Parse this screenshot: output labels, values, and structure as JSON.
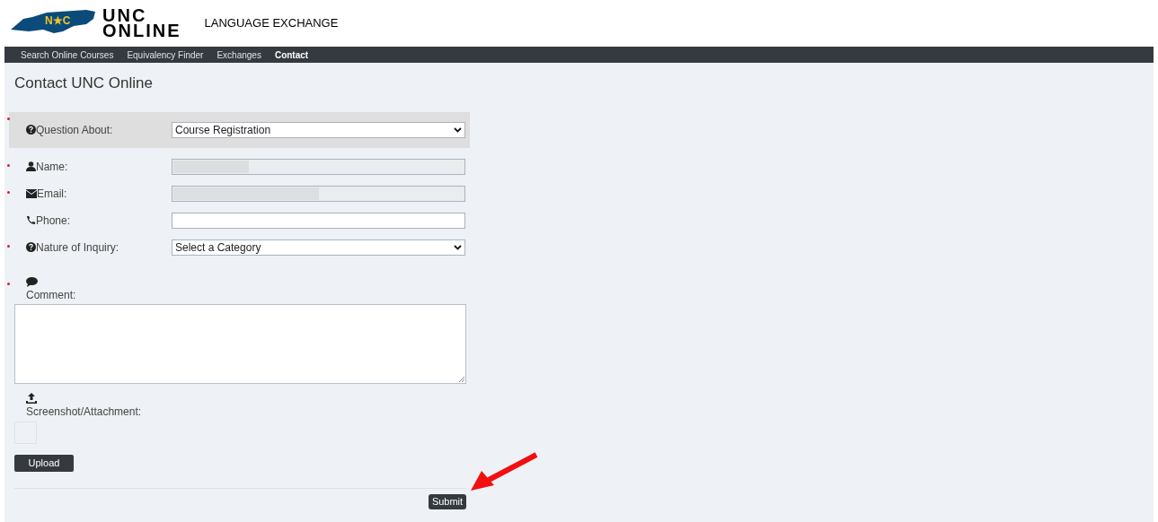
{
  "header": {
    "logo_text": "N★C",
    "brand_line_1": "UNC",
    "brand_line_2": "ONLINE",
    "site_title": "LANGUAGE EXCHANGE"
  },
  "nav": [
    {
      "label": "Search Online Courses",
      "selected": false
    },
    {
      "label": "Equivalency Finder",
      "selected": false
    },
    {
      "label": "Exchanges",
      "selected": false
    },
    {
      "label": "Contact",
      "selected": true
    }
  ],
  "page_title": "Contact UNC Online",
  "fields": [
    {
      "kind": "select",
      "label": "Question About:",
      "value": "Course Registration",
      "required": true,
      "highlighted": true,
      "disabled": false
    },
    {
      "kind": "text",
      "label": "Name:",
      "required": true,
      "highlighted": false,
      "disabled": true
    },
    {
      "kind": "text",
      "label": "Email:",
      "required": true,
      "highlighted": false,
      "disabled": true
    },
    {
      "kind": "text",
      "label": "Phone:",
      "required": false,
      "highlighted": false,
      "disabled": false
    },
    {
      "kind": "select",
      "label": "Nature of Inquiry:",
      "value": "Select a Category",
      "required": true,
      "highlighted": false,
      "disabled": false
    },
    {
      "kind": "textarea",
      "label": "Comment:",
      "required": true,
      "highlighted": false,
      "disabled": false
    },
    {
      "kind": "file",
      "label": "Screenshot/Attachment:",
      "required": false,
      "highlighted": false,
      "disabled": false
    }
  ],
  "upload_button": "Upload",
  "submit_button": "Submit"
}
